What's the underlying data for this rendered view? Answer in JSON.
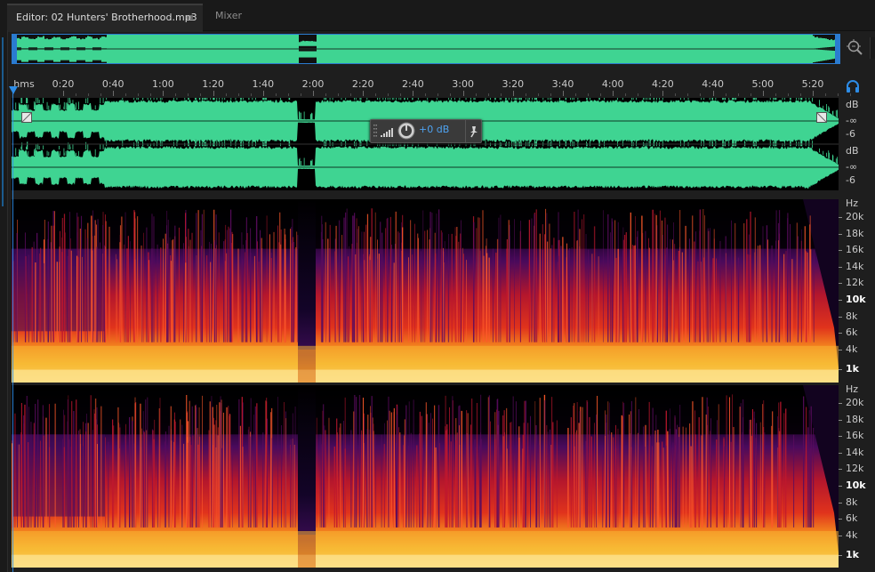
{
  "tabs": {
    "editor_label": "Editor: 02 Hunters' Brotherhood.mp3",
    "editor_menu": "≡",
    "mixer_label": "Mixer"
  },
  "ruler": {
    "unit": "hms",
    "labels": [
      "0:20",
      "0:40",
      "1:00",
      "1:20",
      "1:40",
      "2:00",
      "2:20",
      "2:40",
      "3:00",
      "3:20",
      "3:40",
      "4:00",
      "4:20",
      "4:40",
      "5:00",
      "5:20"
    ]
  },
  "hud": {
    "value": "+0 dB"
  },
  "amplitude_scale": {
    "channel1": [
      "dB",
      "-∞",
      "-6"
    ],
    "channel2": [
      "dB",
      "-∞",
      "-6"
    ]
  },
  "frequency_scale": {
    "unit": "Hz",
    "labels": [
      "20k",
      "18k",
      "16k",
      "14k",
      "12k",
      "10k",
      "8k",
      "6k",
      "4k",
      "1k"
    ],
    "bold": [
      "10k",
      "1k"
    ]
  },
  "colors": {
    "waveform": "#3fd492",
    "playhead": "#2d8ce6",
    "hud_value": "#4ea2f0",
    "selection_border": "#2a7bd0"
  },
  "icons": {
    "zoom": "zoom-magnifier-icon",
    "monitor": "headphones-icon",
    "pin": "pin-icon",
    "knob": "volume-knob-icon"
  }
}
